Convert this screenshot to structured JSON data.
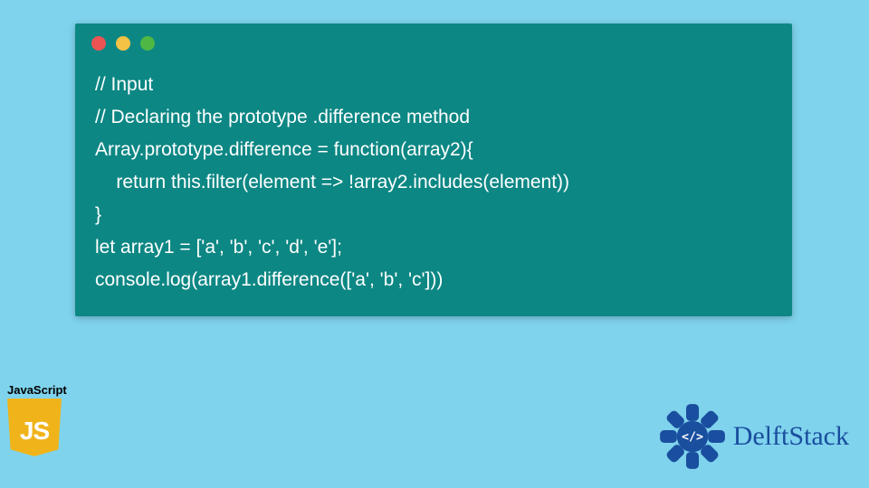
{
  "window": {
    "dots": [
      "red",
      "yellow",
      "green"
    ]
  },
  "code": {
    "lines": [
      "// Input",
      "// Declaring the prototype .difference method",
      "Array.prototype.difference = function(array2){",
      "    return this.filter(element => !array2.includes(element))",
      "}",
      "let array1 = ['a', 'b', 'c', 'd', 'e'];",
      "console.log(array1.difference(['a', 'b', 'c']))"
    ]
  },
  "badges": {
    "js_label": "JavaScript",
    "js_logo_text": "JS",
    "delft_text": "DelftStack"
  },
  "colors": {
    "page_bg": "#7fd3ed",
    "window_bg": "#0c8784",
    "code_fg": "#ffffff",
    "js_bg": "#f0b41a",
    "delft_blue": "#1a4e9e"
  }
}
